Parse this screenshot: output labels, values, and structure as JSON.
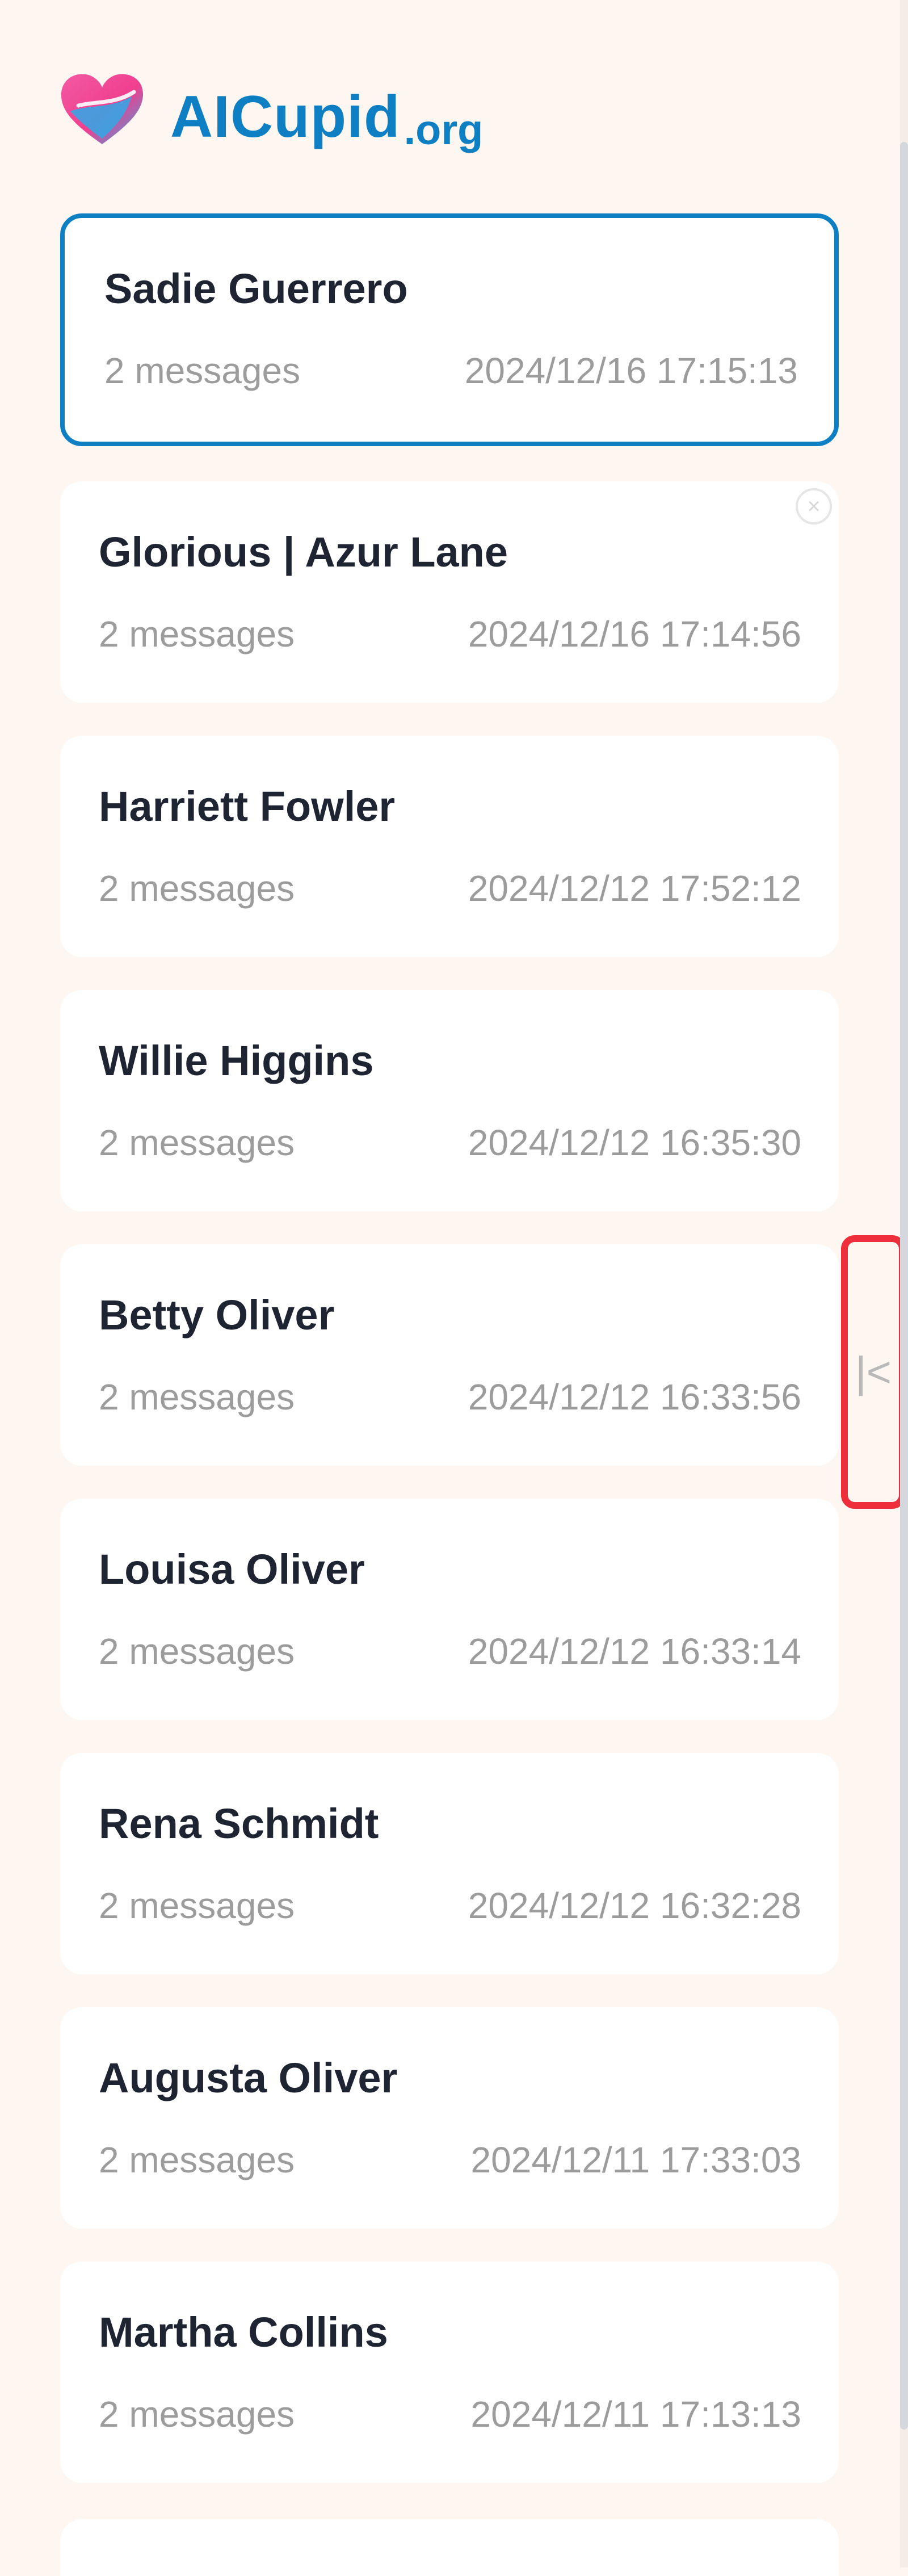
{
  "brand": {
    "name": "AICupid",
    "suffix": ".org",
    "icon": "heart-logo-icon",
    "colors": {
      "accent": "#0f7fc3",
      "heart_pink": "#f03f8e",
      "heart_blue": "#2fa9e8"
    }
  },
  "conversations": [
    {
      "name": "Sadie Guerrero",
      "count": "2 messages",
      "date": "2024/12/16 17:15:13",
      "active": true
    },
    {
      "name": "Glorious | Azur Lane",
      "count": "2 messages",
      "date": "2024/12/16 17:14:56",
      "close_icon": "close-icon"
    },
    {
      "name": "Harriett Fowler",
      "count": "2 messages",
      "date": "2024/12/12 17:52:12"
    },
    {
      "name": "Willie Higgins",
      "count": "2 messages",
      "date": "2024/12/12 16:35:30"
    },
    {
      "name": "Betty Oliver",
      "count": "2 messages",
      "date": "2024/12/12 16:33:56"
    },
    {
      "name": "Louisa Oliver",
      "count": "2 messages",
      "date": "2024/12/12 16:33:14"
    },
    {
      "name": "Rena Schmidt",
      "count": "2 messages",
      "date": "2024/12/12 16:32:28"
    },
    {
      "name": "Augusta Oliver",
      "count": "2 messages",
      "date": "2024/12/11 17:33:03"
    },
    {
      "name": "Martha Collins",
      "count": "2 messages",
      "date": "2024/12/11 17:13:13"
    }
  ],
  "collapse_handle": {
    "icon": "collapse-left-icon",
    "glyph": "|<",
    "highlight_color": "#ee2f3b"
  }
}
